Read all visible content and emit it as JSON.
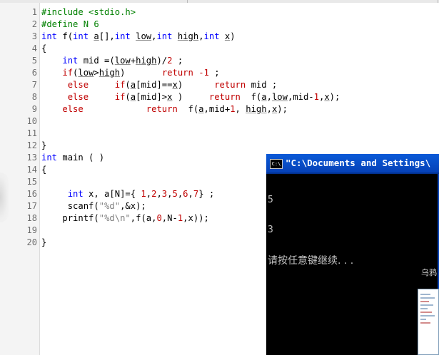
{
  "editor": {
    "lines": [
      {
        "n": "1",
        "tokens": [
          {
            "t": "#include <stdio.h>",
            "c": "pp"
          }
        ]
      },
      {
        "n": "2",
        "tokens": [
          {
            "t": "#define N 6",
            "c": "pp"
          }
        ]
      },
      {
        "n": "3",
        "tokens": [
          {
            "t": "int",
            "c": "kw"
          },
          {
            "t": " f(",
            "c": "op"
          },
          {
            "t": "int",
            "c": "kw"
          },
          {
            "t": " ",
            "c": "op"
          },
          {
            "t": "a",
            "c": "ul"
          },
          {
            "t": "[],",
            "c": "op"
          },
          {
            "t": "int",
            "c": "kw"
          },
          {
            "t": " ",
            "c": "op"
          },
          {
            "t": "low",
            "c": "ul"
          },
          {
            "t": ",",
            "c": "op"
          },
          {
            "t": "int",
            "c": "kw"
          },
          {
            "t": " ",
            "c": "op"
          },
          {
            "t": "high",
            "c": "ul"
          },
          {
            "t": ",",
            "c": "op"
          },
          {
            "t": "int",
            "c": "kw"
          },
          {
            "t": " ",
            "c": "op"
          },
          {
            "t": "x",
            "c": "ul"
          },
          {
            "t": ")",
            "c": "op"
          }
        ]
      },
      {
        "n": "4",
        "tokens": [
          {
            "t": "{",
            "c": "op"
          }
        ]
      },
      {
        "n": "5",
        "tokens": [
          {
            "t": "    ",
            "c": "op"
          },
          {
            "t": "int",
            "c": "kw"
          },
          {
            "t": " mid =(",
            "c": "op"
          },
          {
            "t": "low",
            "c": "ul"
          },
          {
            "t": "+",
            "c": "op"
          },
          {
            "t": "high",
            "c": "ul"
          },
          {
            "t": ")/",
            "c": "op"
          },
          {
            "t": "2",
            "c": "num"
          },
          {
            "t": " ;",
            "c": "op"
          }
        ]
      },
      {
        "n": "6",
        "tokens": [
          {
            "t": "    ",
            "c": "op"
          },
          {
            "t": "if",
            "c": "kw2"
          },
          {
            "t": "(",
            "c": "op"
          },
          {
            "t": "low",
            "c": "ul"
          },
          {
            "t": ">",
            "c": "op"
          },
          {
            "t": "high",
            "c": "ul"
          },
          {
            "t": ")       ",
            "c": "op"
          },
          {
            "t": "return",
            "c": "kw2"
          },
          {
            "t": " ",
            "c": "op"
          },
          {
            "t": "-1",
            "c": "num"
          },
          {
            "t": " ;",
            "c": "op"
          }
        ]
      },
      {
        "n": "7",
        "tokens": [
          {
            "t": "     ",
            "c": "op"
          },
          {
            "t": "else",
            "c": "kw2"
          },
          {
            "t": "     ",
            "c": "op"
          },
          {
            "t": "if",
            "c": "kw2"
          },
          {
            "t": "(",
            "c": "op"
          },
          {
            "t": "a",
            "c": "ul"
          },
          {
            "t": "[mid]==",
            "c": "op"
          },
          {
            "t": "x",
            "c": "ul"
          },
          {
            "t": ")      ",
            "c": "op"
          },
          {
            "t": "return",
            "c": "kw2"
          },
          {
            "t": " mid ;",
            "c": "op"
          }
        ]
      },
      {
        "n": "8",
        "tokens": [
          {
            "t": "     ",
            "c": "op"
          },
          {
            "t": "else",
            "c": "kw2"
          },
          {
            "t": "     ",
            "c": "op"
          },
          {
            "t": "if",
            "c": "kw2"
          },
          {
            "t": "(",
            "c": "op"
          },
          {
            "t": "a",
            "c": "ul"
          },
          {
            "t": "[mid]>",
            "c": "op"
          },
          {
            "t": "x",
            "c": "ul"
          },
          {
            "t": " )     ",
            "c": "op"
          },
          {
            "t": "return",
            "c": "kw2"
          },
          {
            "t": "  f(",
            "c": "op"
          },
          {
            "t": "a",
            "c": "ul"
          },
          {
            "t": ",",
            "c": "op"
          },
          {
            "t": "low",
            "c": "ul"
          },
          {
            "t": ",mid-",
            "c": "op"
          },
          {
            "t": "1",
            "c": "num"
          },
          {
            "t": ",",
            "c": "op"
          },
          {
            "t": "x",
            "c": "ul"
          },
          {
            "t": ");",
            "c": "op"
          }
        ]
      },
      {
        "n": "9",
        "tokens": [
          {
            "t": "    ",
            "c": "op"
          },
          {
            "t": "else",
            "c": "kw2"
          },
          {
            "t": "            ",
            "c": "op"
          },
          {
            "t": "return",
            "c": "kw2"
          },
          {
            "t": "  f(",
            "c": "op"
          },
          {
            "t": "a",
            "c": "ul"
          },
          {
            "t": ",mid+",
            "c": "op"
          },
          {
            "t": "1",
            "c": "num"
          },
          {
            "t": ", ",
            "c": "op"
          },
          {
            "t": "high",
            "c": "ul"
          },
          {
            "t": ",",
            "c": "op"
          },
          {
            "t": "x",
            "c": "ul"
          },
          {
            "t": ");",
            "c": "op"
          }
        ]
      },
      {
        "n": "10",
        "tokens": []
      },
      {
        "n": "11",
        "tokens": []
      },
      {
        "n": "12",
        "tokens": [
          {
            "t": "}",
            "c": "op"
          }
        ]
      },
      {
        "n": "13",
        "tokens": [
          {
            "t": "int",
            "c": "kw"
          },
          {
            "t": " main ( )",
            "c": "op"
          }
        ]
      },
      {
        "n": "14",
        "tokens": [
          {
            "t": "{",
            "c": "op"
          }
        ]
      },
      {
        "n": "15",
        "tokens": []
      },
      {
        "n": "16",
        "tokens": [
          {
            "t": "     ",
            "c": "op"
          },
          {
            "t": "int",
            "c": "kw"
          },
          {
            "t": " x, a[N]={ ",
            "c": "op"
          },
          {
            "t": "1",
            "c": "num"
          },
          {
            "t": ",",
            "c": "op"
          },
          {
            "t": "2",
            "c": "num"
          },
          {
            "t": ",",
            "c": "op"
          },
          {
            "t": "3",
            "c": "num"
          },
          {
            "t": ",",
            "c": "op"
          },
          {
            "t": "5",
            "c": "num"
          },
          {
            "t": ",",
            "c": "op"
          },
          {
            "t": "6",
            "c": "num"
          },
          {
            "t": ",",
            "c": "op"
          },
          {
            "t": "7",
            "c": "num"
          },
          {
            "t": "} ;",
            "c": "op"
          }
        ]
      },
      {
        "n": "17",
        "tokens": [
          {
            "t": "     ",
            "c": "op"
          },
          {
            "t": "scanf(",
            "c": "op"
          },
          {
            "t": "\"%d\"",
            "c": "str"
          },
          {
            "t": ",&x);",
            "c": "op"
          }
        ]
      },
      {
        "n": "18",
        "tokens": [
          {
            "t": "    ",
            "c": "op"
          },
          {
            "t": "printf(",
            "c": "op"
          },
          {
            "t": "\"%d\\n\"",
            "c": "str"
          },
          {
            "t": ",f(a,",
            "c": "op"
          },
          {
            "t": "0",
            "c": "num"
          },
          {
            "t": ",N-",
            "c": "op"
          },
          {
            "t": "1",
            "c": "num"
          },
          {
            "t": ",x));",
            "c": "op"
          }
        ]
      },
      {
        "n": "19",
        "tokens": []
      },
      {
        "n": "20",
        "tokens": [
          {
            "t": "}",
            "c": "op"
          }
        ]
      }
    ]
  },
  "console": {
    "title": "\"C:\\Documents and Settings\\",
    "icon_text": "C:\\",
    "output_lines": [
      "5",
      "3"
    ],
    "prompt": "请按任意键继续. . ."
  },
  "desktop": {
    "label": "乌鸦"
  },
  "colors": {
    "preprocessor": "#008000",
    "keyword_type": "#0000ff",
    "keyword_flow": "#c00000",
    "number": "#c00000",
    "string": "#808080",
    "console_title_bg": "#0b5bd8"
  }
}
